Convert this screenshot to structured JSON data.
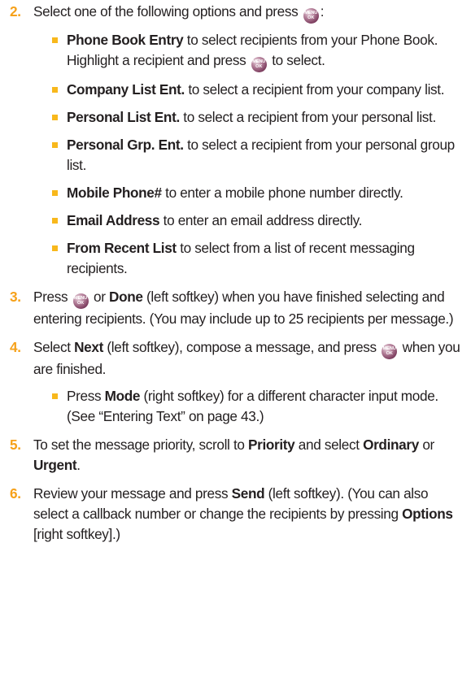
{
  "key_icon": {
    "icon": "menu-ok-key-icon",
    "line1": "MENU",
    "line2": "OK",
    "color": "#7b3b5d"
  },
  "colors": {
    "step_number": "#f6a11a",
    "bullet": "#f8b81c",
    "text": "#231f20"
  },
  "steps": [
    {
      "number": "2.",
      "text_a": "Select one of the following options and press ",
      "text_b": ":",
      "items": [
        {
          "term": "Phone Book Entry",
          "text_a": " to select recipients from your Phone Book. Highlight a recipient and press ",
          "text_b": " to select."
        },
        {
          "term": "Company List Ent.",
          "text": " to select a recipient from your company list."
        },
        {
          "term": "Personal List Ent.",
          "text": " to select a recipient from your personal list."
        },
        {
          "term": "Personal Grp. Ent.",
          "text": " to select a recipient from your personal group list."
        },
        {
          "term": "Mobile Phone#",
          "text": " to enter a mobile phone number directly."
        },
        {
          "term": "Email Address",
          "text": " to enter an email address directly."
        },
        {
          "term": "From Recent List",
          "text": " to select from a list of recent messaging recipients."
        }
      ]
    },
    {
      "number": "3.",
      "text_a": "Press ",
      "text_b": " or ",
      "bold": "Done",
      "text_c": " (left softkey) when you have finished selecting and entering recipients. (You may include up to 25 recipients per message.)"
    },
    {
      "number": "4.",
      "text_a": "Select ",
      "bold": "Next",
      "text_b": " (left softkey), compose a message, and press ",
      "text_c": " when you are finished.",
      "items": [
        {
          "text_a": "Press ",
          "term": "Mode",
          "text_b": " (right softkey) for a different character input mode. (See “Entering Text” on page 43.)"
        }
      ]
    },
    {
      "number": "5.",
      "text_a": "To set the message priority, scroll to ",
      "bold1": "Priority",
      "text_b": " and select ",
      "bold2": "Ordinary",
      "text_c": " or ",
      "bold3": "Urgent",
      "text_d": "."
    },
    {
      "number": "6.",
      "text_a": "Review your message and press ",
      "bold1": "Send",
      "text_b": " (left softkey). (You can also select a callback number or change the recipients by pressing ",
      "bold2": "Options",
      "text_c": " [right softkey].)"
    }
  ]
}
